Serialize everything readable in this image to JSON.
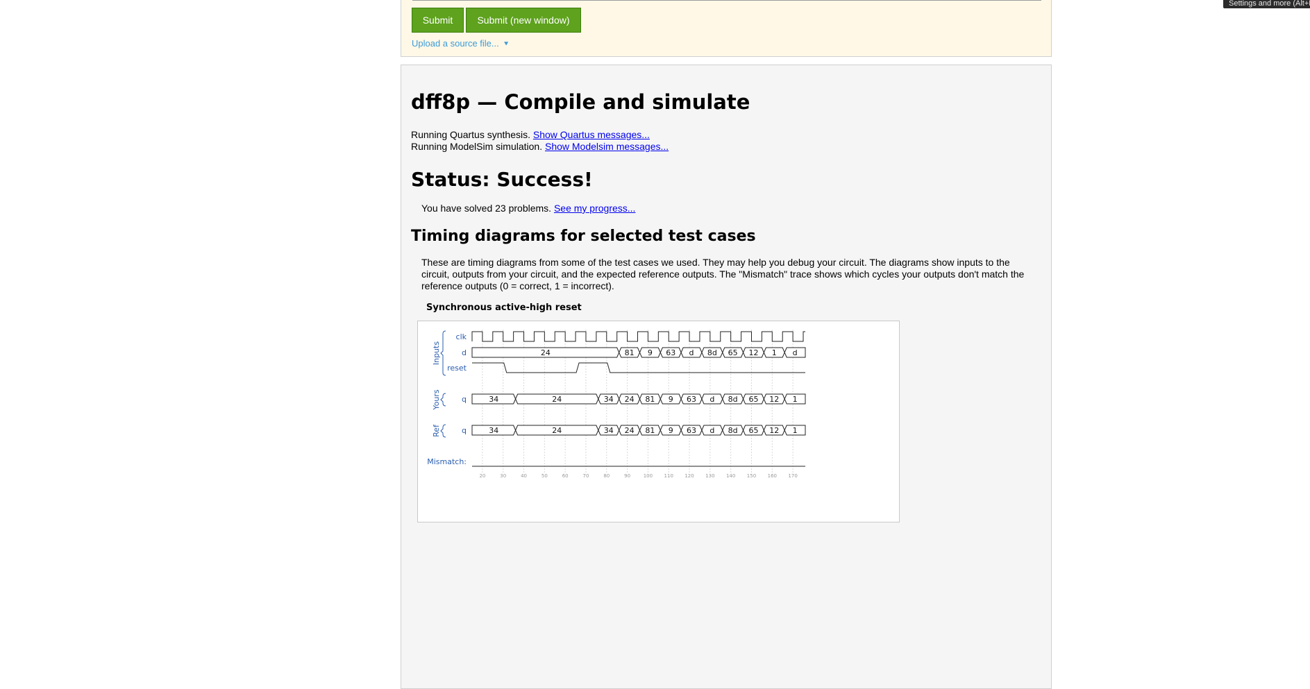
{
  "tooltip": {
    "text": "Settings and more (Alt+F)"
  },
  "submit_panel": {
    "submit_label": "Submit",
    "submit_new_window_label": "Submit (new window)",
    "upload_label": "Upload a source file..."
  },
  "result": {
    "title": "dff8p — Compile and simulate",
    "quartus_text": "Running Quartus synthesis.",
    "quartus_link": "Show Quartus messages...",
    "modelsim_text": "Running ModelSim simulation.",
    "modelsim_link": "Show Modelsim messages...",
    "status_heading": "Status: Success!",
    "solved_text": "You have solved 23 problems.",
    "progress_link": "See my progress...",
    "timing_heading": "Timing diagrams for selected test cases",
    "timing_paragraph": "These are timing diagrams from some of the test cases we used. They may help you debug your circuit. The diagrams show inputs to the circuit, outputs from your circuit, and the expected reference outputs. The \"Mismatch\" trace shows which cycles your outputs don't match the reference outputs (0 = correct, 1 = incorrect)."
  },
  "figure": {
    "title": "Synchronous active-high reset",
    "groups": {
      "inputs": "Inputs",
      "yours": "Yours",
      "ref": "Ref"
    },
    "mismatch_label": "Mismatch:",
    "colors": {
      "label": "#2a5db0",
      "trace": "#222222",
      "grid": "#d8d8d8"
    }
  },
  "chart_data": {
    "type": "timing",
    "title": "Synchronous active-high reset",
    "x_ticks": [
      20,
      30,
      40,
      50,
      60,
      70,
      80,
      90,
      100,
      110,
      120,
      130,
      140,
      150,
      160,
      170
    ],
    "x_range": [
      15,
      176
    ],
    "clock": {
      "name": "clk",
      "first_rise": 15,
      "period": 10
    },
    "signals": [
      {
        "group": "Inputs",
        "name": "d",
        "kind": "bus",
        "segments": [
          [
            15,
            86,
            "24"
          ],
          [
            86,
            96,
            "81"
          ],
          [
            96,
            106,
            "9"
          ],
          [
            106,
            116,
            "63"
          ],
          [
            116,
            126,
            "d"
          ],
          [
            126,
            136,
            "8d"
          ],
          [
            136,
            146,
            "65"
          ],
          [
            146,
            156,
            "12"
          ],
          [
            156,
            166,
            "1"
          ],
          [
            166,
            176,
            "d"
          ]
        ]
      },
      {
        "group": "Inputs",
        "name": "reset",
        "kind": "bit",
        "transitions": [
          [
            15,
            1
          ],
          [
            31,
            0
          ],
          [
            66,
            1
          ],
          [
            81,
            0
          ],
          [
            176,
            0
          ]
        ]
      },
      {
        "group": "Yours",
        "name": "q",
        "kind": "bus",
        "segments": [
          [
            15,
            36,
            "34"
          ],
          [
            36,
            76,
            "24"
          ],
          [
            76,
            86,
            "34"
          ],
          [
            86,
            96,
            "24"
          ],
          [
            96,
            106,
            "81"
          ],
          [
            106,
            116,
            "9"
          ],
          [
            116,
            126,
            "63"
          ],
          [
            126,
            136,
            "d"
          ],
          [
            136,
            146,
            "8d"
          ],
          [
            146,
            156,
            "65"
          ],
          [
            156,
            166,
            "12"
          ],
          [
            166,
            176,
            "1"
          ]
        ]
      },
      {
        "group": "Ref",
        "name": "q",
        "kind": "bus",
        "segments": [
          [
            15,
            36,
            "34"
          ],
          [
            36,
            76,
            "24"
          ],
          [
            76,
            86,
            "34"
          ],
          [
            86,
            96,
            "24"
          ],
          [
            96,
            106,
            "81"
          ],
          [
            106,
            116,
            "9"
          ],
          [
            116,
            126,
            "63"
          ],
          [
            126,
            136,
            "d"
          ],
          [
            136,
            146,
            "8d"
          ],
          [
            146,
            156,
            "65"
          ],
          [
            156,
            166,
            "12"
          ],
          [
            166,
            176,
            "1"
          ]
        ]
      },
      {
        "group": "",
        "name": "Mismatch:",
        "kind": "bit",
        "transitions": [
          [
            15,
            0
          ],
          [
            176,
            0
          ]
        ]
      }
    ]
  }
}
